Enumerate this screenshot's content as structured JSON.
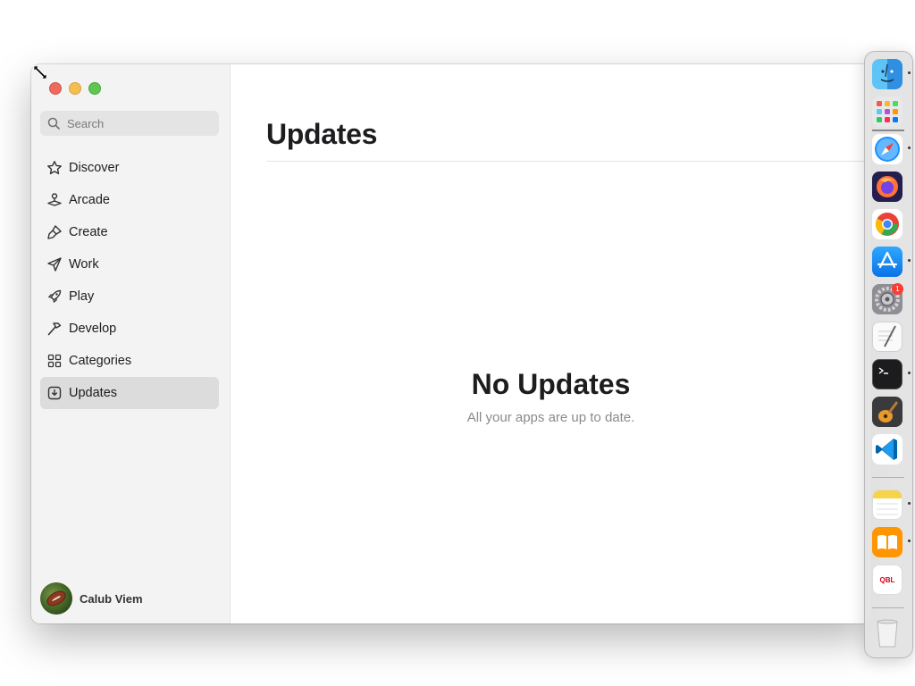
{
  "sidebar": {
    "search_placeholder": "Search",
    "items": [
      {
        "label": "Discover"
      },
      {
        "label": "Arcade"
      },
      {
        "label": "Create"
      },
      {
        "label": "Work"
      },
      {
        "label": "Play"
      },
      {
        "label": "Develop"
      },
      {
        "label": "Categories"
      },
      {
        "label": "Updates"
      }
    ],
    "active_item": "Updates",
    "user": {
      "name": "Calub Viem"
    }
  },
  "main": {
    "title": "Updates",
    "empty_title": "No Updates",
    "empty_subtitle": "All your apps are up to date."
  },
  "dock": {
    "apps": [
      "Finder",
      "Launchpad",
      "Safari",
      "Firefox",
      "Chrome",
      "App Store",
      "System Settings",
      "TextEdit",
      "Terminal",
      "GarageBand",
      "VS Code",
      "Notes",
      "Books",
      "QBL",
      "Trash"
    ],
    "system_settings_badge": "1",
    "qbl_label": "QBL"
  }
}
